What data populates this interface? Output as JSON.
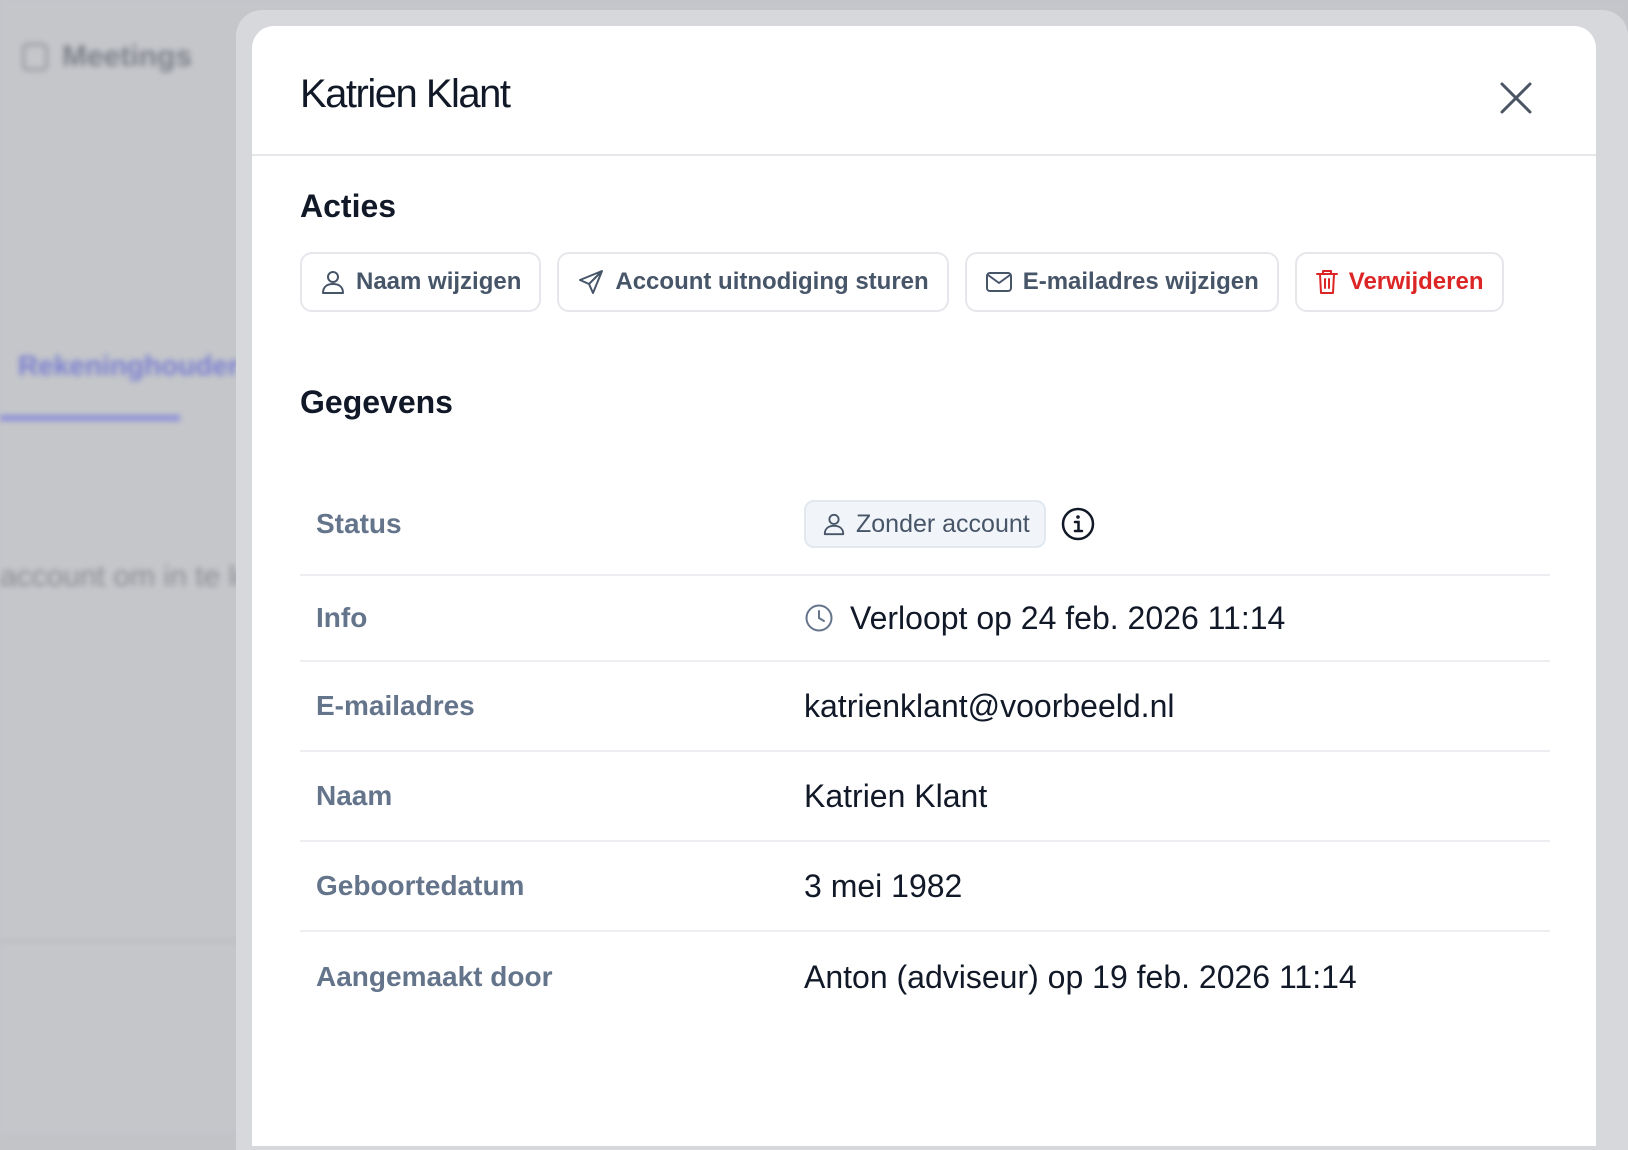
{
  "background": {
    "app_title": "Meetings",
    "tab_label": "Rekeninghouders",
    "text_fragment": "account om in te lo"
  },
  "modal": {
    "title": "Katrien Klant",
    "close_icon": "close-icon"
  },
  "actions": {
    "title": "Acties",
    "buttons": [
      {
        "label": "Naam wijzigen",
        "icon": "user-icon"
      },
      {
        "label": "Account uitnodiging sturen",
        "icon": "send-icon"
      },
      {
        "label": "E-mailadres wijzigen",
        "icon": "mail-icon"
      },
      {
        "label": "Verwijderen",
        "icon": "trash-icon",
        "color": "#dc2626"
      }
    ]
  },
  "details": {
    "title": "Gegevens",
    "status": {
      "label": "Status",
      "badge": "Zonder account",
      "badge_icon": "user-icon",
      "info_icon": "info-icon"
    },
    "info": {
      "label": "Info",
      "value": "Verloopt op 24 feb. 2026 11:14",
      "icon": "clock-icon"
    },
    "email": {
      "label": "E-mailadres",
      "value": "katrienklant@voorbeeld.nl"
    },
    "name": {
      "label": "Naam",
      "value": "Katrien Klant"
    },
    "birthdate": {
      "label": "Geboortedatum",
      "value": "3 mei 1982"
    },
    "created_by": {
      "label": "Aangemaakt door",
      "value": "Anton (adviseur) op 19 feb. 2026 11:14"
    }
  },
  "colors": {
    "accent_danger": "#dc2626",
    "label_gray": "#64748b",
    "text_dark": "#111827"
  }
}
